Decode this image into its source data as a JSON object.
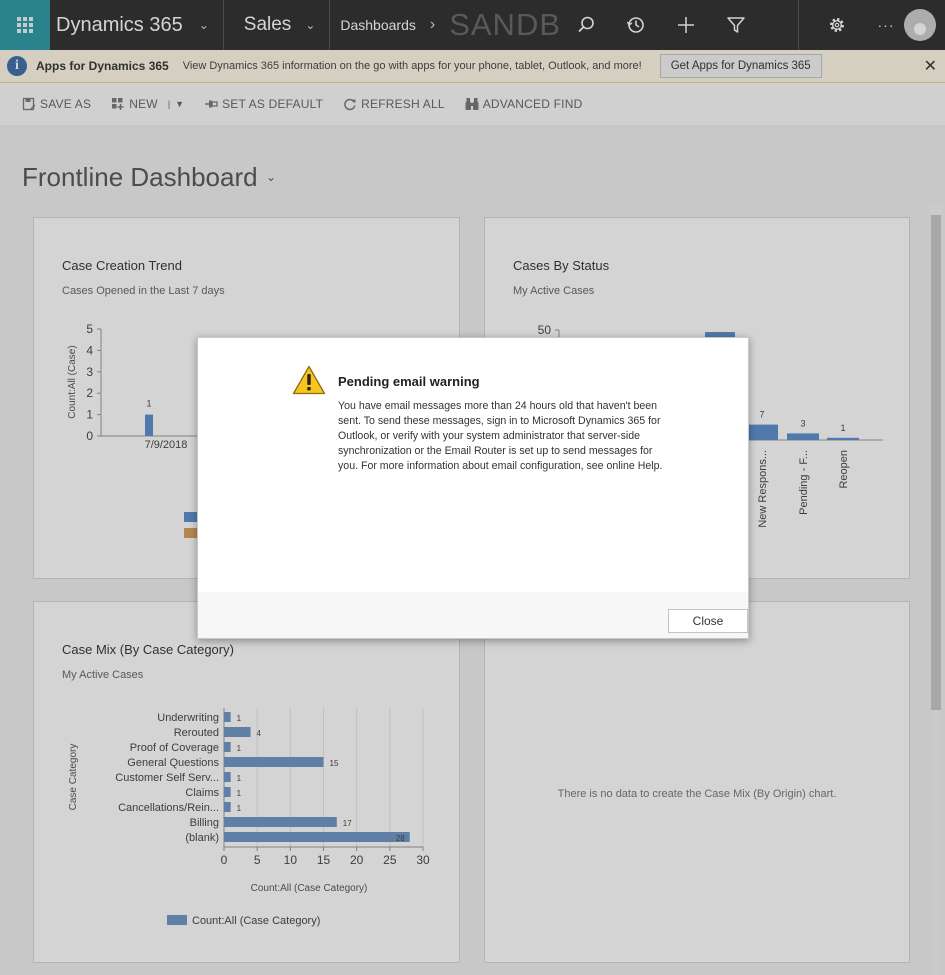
{
  "nav": {
    "app_name": "Dynamics 365",
    "area": "Sales",
    "breadcrumb": "Dashboards",
    "environment": "SANDBOX"
  },
  "notification": {
    "title": "Apps for Dynamics 365",
    "text": "View Dynamics 365 information on the go with apps for your phone, tablet, Outlook, and more!",
    "button": "Get Apps for Dynamics 365"
  },
  "commands": {
    "save_as": "SAVE AS",
    "new": "NEW",
    "set_default": "SET AS DEFAULT",
    "refresh_all": "REFRESH ALL",
    "advanced_find": "ADVANCED FIND"
  },
  "dashboard": {
    "title": "Frontline Dashboard"
  },
  "panels": {
    "trend": {
      "title": "Case Creation Trend",
      "subtitle": "Cases Opened in the Last 7 days"
    },
    "status": {
      "title": "Cases By Status",
      "subtitle": "My Active Cases"
    },
    "mix": {
      "title": "Case Mix (By Case Category)",
      "subtitle": "My Active Cases"
    },
    "origin": {
      "empty_message": "There is no data to create the Case Mix (By Origin) chart."
    }
  },
  "chart_data": [
    {
      "type": "bar",
      "title": "Case Creation Trend",
      "ylabel": "Count:All (Case)",
      "ylim": [
        0,
        5
      ],
      "yticks": [
        "0",
        "1",
        "2",
        "3",
        "4",
        "5"
      ],
      "categories": [
        "7/9/2018"
      ],
      "values": [
        1
      ],
      "color": "#5b8fd0"
    },
    {
      "type": "bar",
      "title": "Cases By Status",
      "yticks": [
        "50"
      ],
      "categories": [
        "New Respons...",
        "Pending - F...",
        "Reopen"
      ],
      "values": [
        7,
        3,
        1
      ],
      "color": "#5b8fd0"
    },
    {
      "type": "bar",
      "orientation": "horizontal",
      "title": "Case Mix (By Case Category)",
      "xlabel": "Count:All (Case Category)",
      "ylabel": "Case Category",
      "xlim": [
        0,
        30
      ],
      "xticks": [
        "0",
        "5",
        "10",
        "15",
        "20",
        "25",
        "30"
      ],
      "categories": [
        "Underwriting",
        "Rerouted",
        "Proof of Coverage",
        "General Questions",
        "Customer Self Serv...",
        "Claims",
        "Cancellations/Rein...",
        "Billing",
        "(blank)"
      ],
      "values": [
        1,
        4,
        1,
        15,
        1,
        1,
        1,
        17,
        28
      ],
      "legend": "Count:All (Case Category)",
      "color": "#6f95c4"
    }
  ],
  "dialog": {
    "title": "Pending email warning",
    "body": "You have email messages more than 24 hours old that haven't been sent. To send these messages, sign in to Microsoft Dynamics 365 for Outlook, or verify with your system administrator that server-side synchronization or the Email Router is set up to send messages for you. For more information about email configuration, see online Help.",
    "close": "Close"
  }
}
